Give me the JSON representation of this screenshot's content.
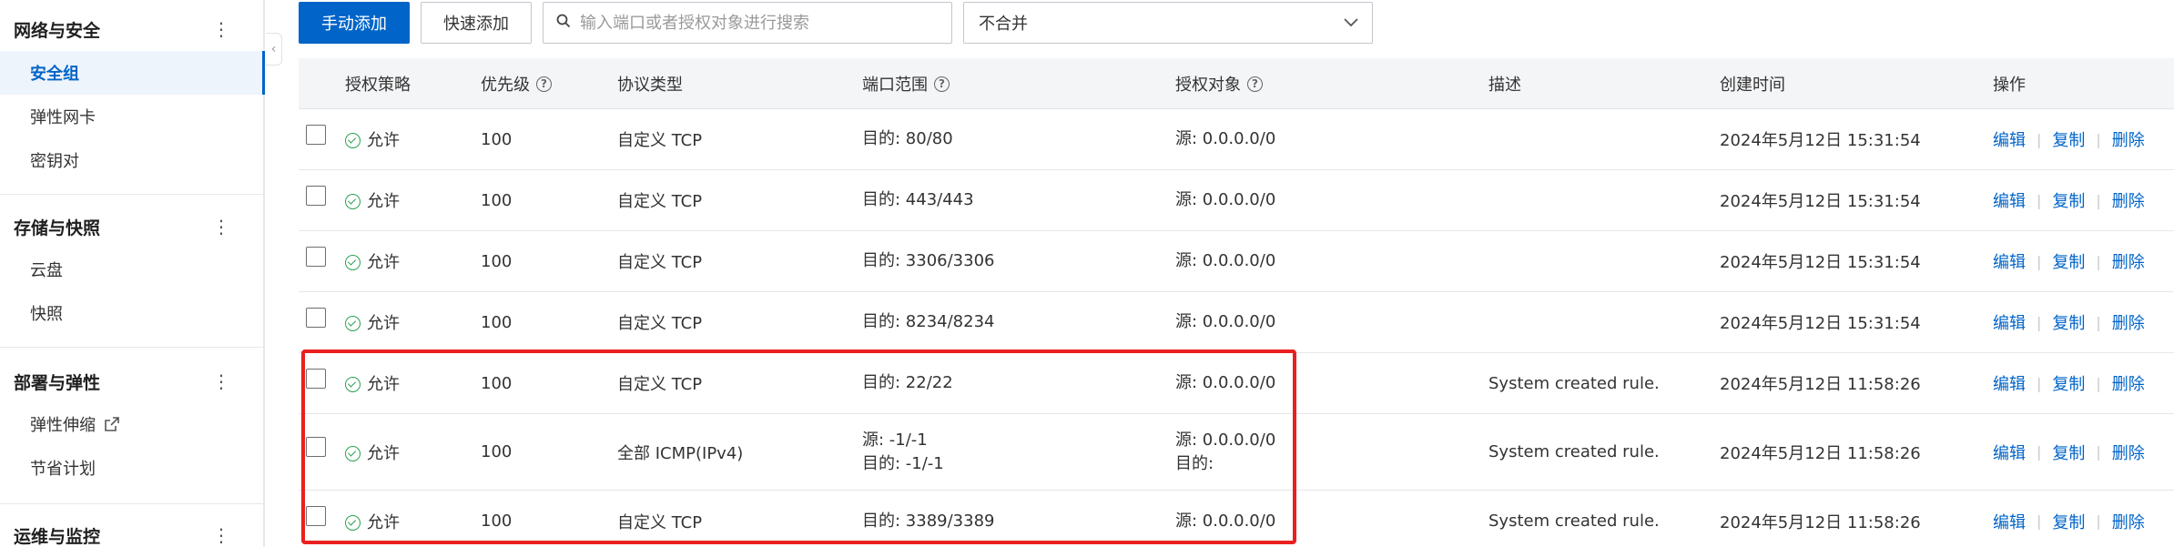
{
  "sidebar": {
    "groups": [
      {
        "title": "网络与安全",
        "items": [
          {
            "label": "安全组",
            "active": true
          },
          {
            "label": "弹性网卡"
          },
          {
            "label": "密钥对"
          }
        ]
      },
      {
        "title": "存储与快照",
        "items": [
          {
            "label": "云盘"
          },
          {
            "label": "快照"
          }
        ]
      },
      {
        "title": "部署与弹性",
        "items": [
          {
            "label": "弹性伸缩",
            "external": true
          },
          {
            "label": "节省计划"
          }
        ]
      },
      {
        "title": "运维与监控",
        "items": []
      }
    ],
    "menu_icon": "more-vertical-icon",
    "external_icon": "external-link-icon",
    "collapse_icon": "chevron-left-icon"
  },
  "toolbar": {
    "manual_add_label": "手动添加",
    "quick_add_label": "快速添加",
    "search_placeholder": "输入端口或者授权对象进行搜索",
    "search_icon": "search-icon",
    "merge_select_value": "不合并",
    "merge_select_icon": "chevron-down-icon"
  },
  "table": {
    "columns": [
      "授权策略",
      "优先级",
      "协议类型",
      "端口范围",
      "授权对象",
      "描述",
      "创建时间",
      "操作"
    ],
    "help_columns": [
      "优先级",
      "端口范围",
      "授权对象"
    ],
    "ops": [
      "编辑",
      "复制",
      "删除"
    ],
    "rows": [
      {
        "policy": "允许",
        "priority": "100",
        "protocol": "自定义 TCP",
        "port": [
          "目的: 80/80"
        ],
        "object": [
          "源: 0.0.0.0/0"
        ],
        "desc": "",
        "time": "2024年5月12日 15:31:54"
      },
      {
        "policy": "允许",
        "priority": "100",
        "protocol": "自定义 TCP",
        "port": [
          "目的: 443/443"
        ],
        "object": [
          "源: 0.0.0.0/0"
        ],
        "desc": "",
        "time": "2024年5月12日 15:31:54"
      },
      {
        "policy": "允许",
        "priority": "100",
        "protocol": "自定义 TCP",
        "port": [
          "目的: 3306/3306"
        ],
        "object": [
          "源: 0.0.0.0/0"
        ],
        "desc": "",
        "time": "2024年5月12日 15:31:54"
      },
      {
        "policy": "允许",
        "priority": "100",
        "protocol": "自定义 TCP",
        "port": [
          "目的: 8234/8234"
        ],
        "object": [
          "源: 0.0.0.0/0"
        ],
        "desc": "",
        "time": "2024年5月12日 15:31:54"
      },
      {
        "policy": "允许",
        "priority": "100",
        "protocol": "自定义 TCP",
        "port": [
          "目的: 22/22"
        ],
        "object": [
          "源: 0.0.0.0/0"
        ],
        "desc": "System created rule.",
        "time": "2024年5月12日 11:58:26"
      },
      {
        "policy": "允许",
        "priority": "100",
        "protocol": "全部 ICMP(IPv4)",
        "port": [
          "源: -1/-1",
          "目的: -1/-1"
        ],
        "object": [
          "源: 0.0.0.0/0",
          "目的:"
        ],
        "desc": "System created rule.",
        "time": "2024年5月12日 11:58:26"
      },
      {
        "policy": "允许",
        "priority": "100",
        "protocol": "自定义 TCP",
        "port": [
          "目的: 3389/3389"
        ],
        "object": [
          "源: 0.0.0.0/0"
        ],
        "desc": "System created rule.",
        "time": "2024年5月12日 11:58:26"
      }
    ]
  },
  "colors": {
    "accent": "#0064c8",
    "success": "#2aa14f",
    "highlight": "#ea1f1f"
  }
}
